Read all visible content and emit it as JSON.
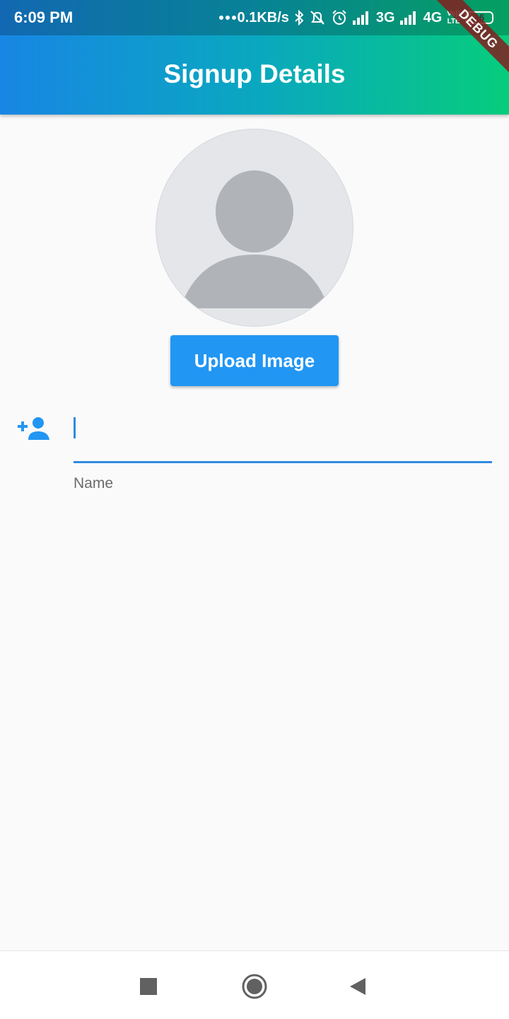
{
  "status_bar": {
    "time": "6:09 PM",
    "speed": "0.1KB/s",
    "network1": "3G",
    "network2": "4G",
    "volte_line1": "Vo))",
    "volte_line2": "LTE",
    "battery": "16",
    "battery_level": 0.16
  },
  "app_bar": {
    "title": "Signup Details",
    "debug_banner": "DEBUG"
  },
  "profile": {
    "upload_button": "Upload Image"
  },
  "form": {
    "name_value": "",
    "name_label": "Name"
  },
  "colors": {
    "accent": "#2196f3",
    "underline": "#2f8ae0",
    "gradient_start": "#1886e4",
    "gradient_end": "#06cd7c"
  },
  "icons": {
    "field_icon": "person-add-icon",
    "nav": [
      "recents-square-icon",
      "home-circle-icon",
      "back-triangle-icon"
    ]
  }
}
